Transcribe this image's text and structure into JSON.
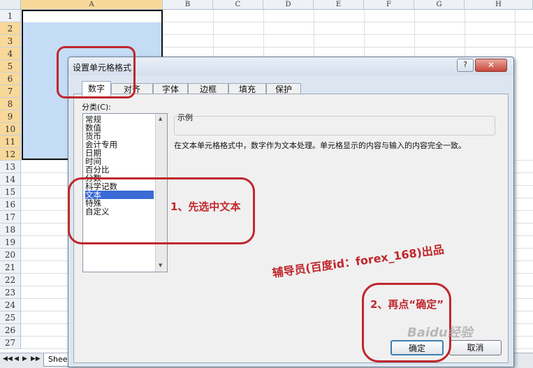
{
  "sheet": {
    "columns": [
      "A",
      "B",
      "C",
      "D",
      "E",
      "F",
      "G",
      "H"
    ],
    "rows": [
      "1",
      "2",
      "3",
      "4",
      "5",
      "6",
      "7",
      "8",
      "9",
      "10",
      "11",
      "12",
      "13",
      "14",
      "15",
      "16",
      "17",
      "18",
      "19",
      "20",
      "21",
      "22",
      "23",
      "24",
      "25",
      "26",
      "27"
    ],
    "sheet_tab": "Shee",
    "nav_buttons": [
      "◀◀",
      "◀",
      "▶",
      "▶▶"
    ]
  },
  "dialog": {
    "title": "设置单元格格式",
    "help": "?",
    "close": "✕",
    "tabs": [
      "数字",
      "对齐",
      "字体",
      "边框",
      "填充",
      "保护"
    ],
    "active_tab": "数字",
    "category_label": "分类(C):",
    "categories": [
      "常规",
      "数值",
      "货币",
      "会计专用",
      "日期",
      "时间",
      "百分比",
      "分数",
      "科学记数",
      "文本",
      "特殊",
      "自定义"
    ],
    "selected_category": "文本",
    "sample_label": "示例",
    "description": "在文本单元格格式中，数字作为文本处理。单元格显示的内容与输入的内容完全一致。",
    "ok": "确定",
    "cancel": "取消"
  },
  "annotations": {
    "step1": "1、先选中文本",
    "step2": "2、再点“确定”",
    "credit": "辅导员(百度id：forex_168)出品",
    "watermark": "Baidu经验"
  }
}
